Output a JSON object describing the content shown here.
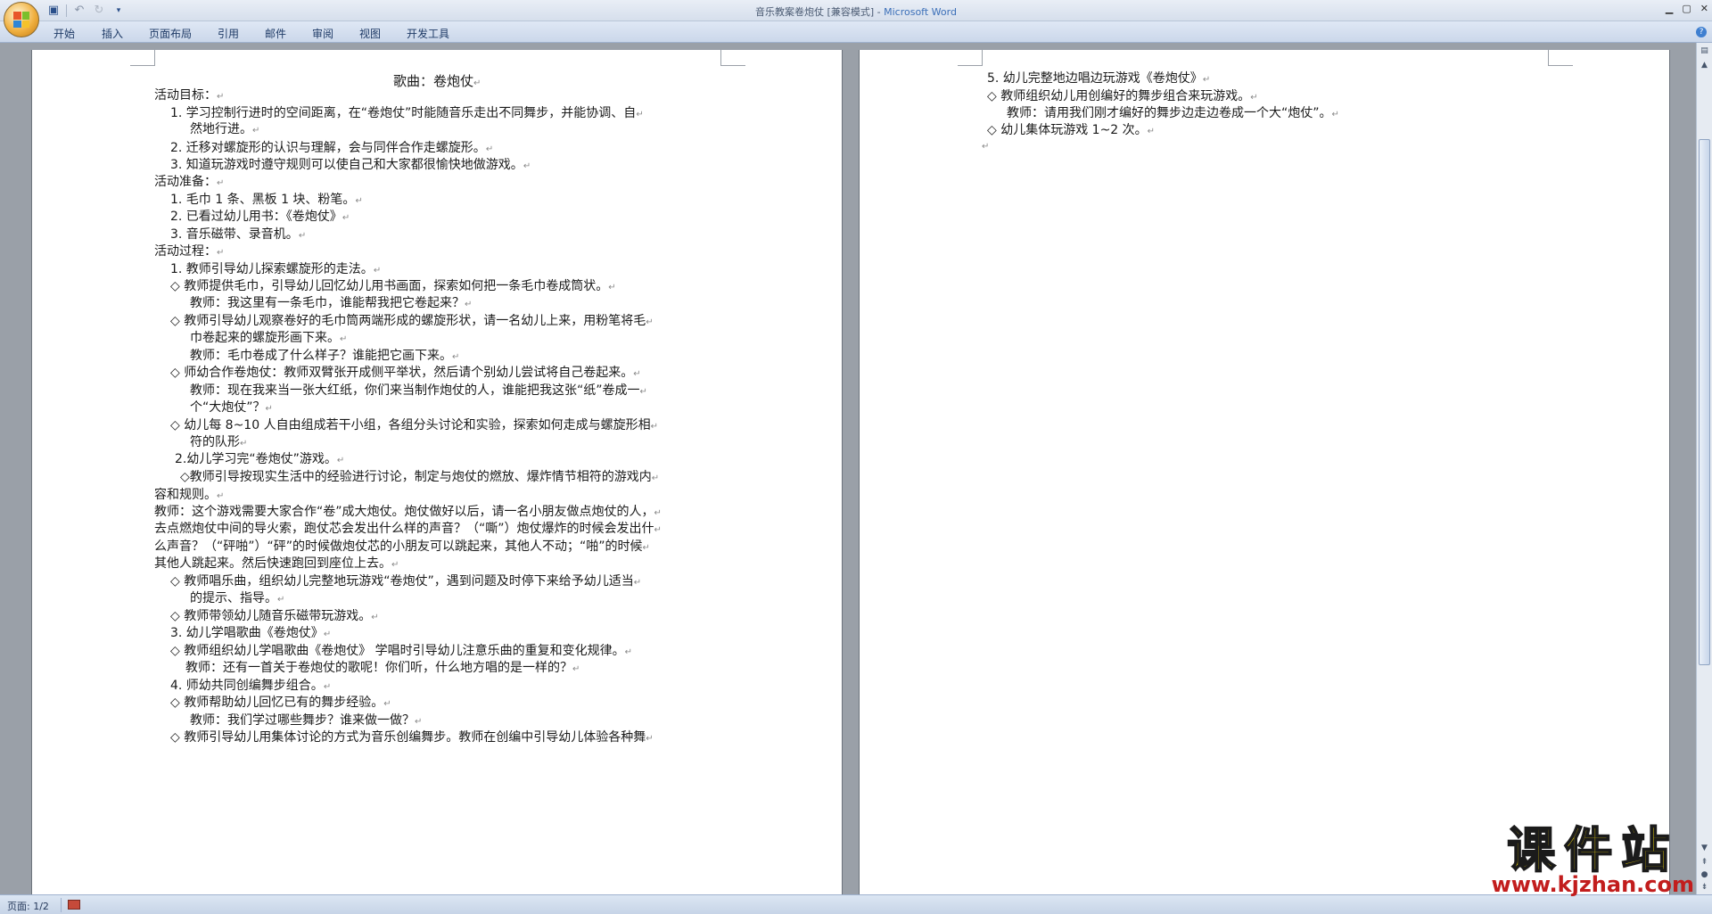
{
  "window": {
    "title": "音乐教案卷炮仗 [兼容模式]",
    "app_name": "Microsoft Word",
    "title_separator": " - "
  },
  "ribbon": {
    "tabs": [
      "开始",
      "插入",
      "页面布局",
      "引用",
      "邮件",
      "审阅",
      "视图",
      "开发工具"
    ]
  },
  "document": {
    "page1": {
      "title": "歌曲：卷炮仗",
      "lines": [
        "活动目标：",
        "1.   学习控制行进时的空间距离，在“卷炮仗”时能随音乐走出不同舞步，并能协调、自",
        "然地行进。",
        "2.   迁移对螺旋形的认识与理解，会与同伴合作走螺旋形。",
        "3.   知道玩游戏时遵守规则可以使自己和大家都很愉快地做游戏。",
        "活动准备：",
        "1.   毛巾 1 条、黑板 1 块、粉笔。",
        "2.   已看过幼儿用书：《卷炮仗》",
        "3.   音乐磁带、录音机。",
        "活动过程：",
        "1.   教师引导幼儿探索螺旋形的走法。",
        "◇   教师提供毛巾，引导幼儿回忆幼儿用书画面，探索如何把一条毛巾卷成筒状。",
        "教师：我这里有一条毛巾，谁能帮我把它卷起来？",
        "◇   教师引导幼儿观察卷好的毛巾筒两端形成的螺旋形状，请一名幼儿上来，用粉笔将毛",
        "巾卷起来的螺旋形画下来。",
        "教师：毛巾卷成了什么样子？谁能把它画下来。",
        "◇   师幼合作卷炮仗：教师双臂张开成侧平举状，然后请个别幼儿尝试将自己卷起来。",
        "教师：现在我来当一张大红纸，你们来当制作炮仗的人，谁能把我这张“纸”卷成一",
        "个“大炮仗”？",
        "◇   幼儿每 8~10 人自由组成若干小组，各组分头讨论和实验，探索如何走成与螺旋形相",
        "符的队形",
        "2.幼儿学习完“卷炮仗”游戏。",
        "◇教师引导按现实生活中的经验进行讨论，制定与炮仗的燃放、爆炸情节相符的游戏内",
        "容和规则。",
        "教师：这个游戏需要大家合作“卷”成大炮仗。炮仗做好以后，请一名小朋友做点炮仗的人，",
        "去点燃炮仗中间的导火索，跑仗芯会发出什么样的声音？（“嘶”）炮仗爆炸的时候会发出什",
        "么声音？（“砰啪”）“砰”的时候做炮仗芯的小朋友可以跳起来，其他人不动；“啪”的时候",
        "其他人跳起来。然后快速跑回到座位上去。",
        "◇   教师唱乐曲，组织幼儿完整地玩游戏“卷炮仗”，遇到问题及时停下来给予幼儿适当",
        "的提示、指导。",
        "◇   教师带领幼儿随音乐磁带玩游戏。",
        "3.  幼儿学唱歌曲《卷炮仗》",
        "◇  教师组织幼儿学唱歌曲《卷炮仗》 学唱时引导幼儿注意乐曲的重复和变化规律。",
        "教师：还有一首关于卷炮仗的歌呢！你们听，什么地方唱的是一样的？",
        "4.   师幼共同创编舞步组合。",
        "◇   教师帮助幼儿回忆已有的舞步经验。",
        "教师：我们学过哪些舞步？谁来做一做？",
        "◇   教师引导幼儿用集体讨论的方式为音乐创编舞步。教师在创编中引导幼儿体验各种舞"
      ]
    },
    "page2": {
      "lines": [
        "5.   幼儿完整地边唱边玩游戏《卷炮仗》",
        "◇   教师组织幼儿用创编好的舞步组合来玩游戏。",
        "教师：请用我们刚才编好的舞步边走边卷成一个大“炮仗”。",
        "◇   幼儿集体玩游戏 1~2 次。"
      ]
    },
    "paragraph_mark": "↵"
  },
  "status_bar": {
    "page_label": "页面: 1/2"
  },
  "watermark": {
    "text": "课件站",
    "url": "www.kjzhan.com"
  },
  "colors": {
    "app_title": "#3b6fb8",
    "watermark_text": "#f1d60c",
    "watermark_url": "#c21d1d"
  }
}
